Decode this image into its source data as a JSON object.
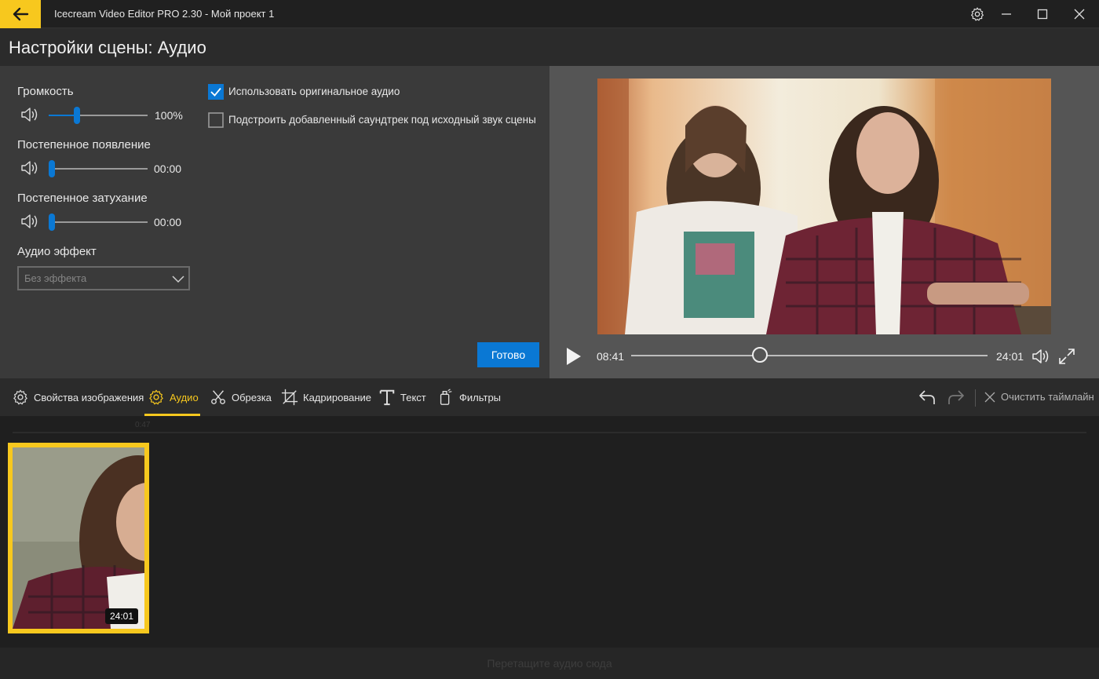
{
  "titlebar": {
    "app_title": "Icecream Video Editor PRO 2.30  -  Мой проект 1"
  },
  "header": {
    "title": "Настройки сцены: Аудио"
  },
  "settings": {
    "volume": {
      "label": "Громкость",
      "value_text": "100%",
      "level": 0.27
    },
    "fade_in": {
      "label": "Постепенное появление",
      "value_text": "00:00",
      "level": 0.0
    },
    "fade_out": {
      "label": "Постепенное затухание",
      "value_text": "00:00",
      "level": 0.0
    },
    "audio_effect": {
      "label": "Аудио эффект",
      "selected": "Без эффекта"
    },
    "use_original_audio": {
      "label": "Использовать оригинальное аудио",
      "checked": true
    },
    "adjust_soundtrack": {
      "label": "Подстроить добавленный саундтрек под исходный звук сцены",
      "checked": false
    },
    "done_label": "Готово"
  },
  "player": {
    "current_time": "08:41",
    "total_time": "24:01",
    "progress": 0.361
  },
  "tabs": [
    {
      "label": "Свойства изображения",
      "icon": "gear-icon"
    },
    {
      "label": "Аудио",
      "icon": "gear-icon",
      "active": true
    },
    {
      "label": "Обрезка",
      "icon": "scissors-icon"
    },
    {
      "label": "Кадрирование",
      "icon": "crop-icon"
    },
    {
      "label": "Текст",
      "icon": "text-icon"
    },
    {
      "label": "Фильтры",
      "icon": "filter-icon"
    }
  ],
  "toolbar": {
    "clear_label": "Очистить таймлайн"
  },
  "timeline": {
    "ruler_label": "0:47",
    "clip_duration": "24:01",
    "audio_drop_hint": "Перетащите аудио сюда"
  },
  "colors": {
    "accent": "#f7c81e",
    "blue": "#0a78d4"
  }
}
